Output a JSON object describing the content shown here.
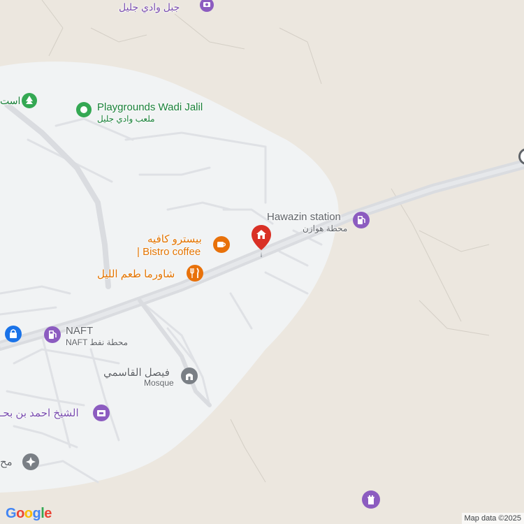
{
  "map": {
    "labels": {
      "jabal_wadi_jalil": "جبل وادي جليل",
      "playgrounds_en": "Playgrounds Wadi Jalil",
      "playgrounds_ar": "ملعب وادي جليل",
      "hawazin_en": "Hawazin station",
      "hawazin_ar": "محطة هوازن",
      "bistro_ar": "بيسترو كافيه",
      "bistro_en": "| Bistro coffee",
      "shawarma_ar": "شاورما طعم الليل",
      "naft_en": "NAFT",
      "naft_ar": "NAFT محطة نفط",
      "faisal_ar": "فيصل القاسمي",
      "faisal_en": "Mosque",
      "sheikh_ar": "الشيخ احمد بن بحـ",
      "left_edge_top": "است",
      "left_edge_bottom": "مح"
    },
    "attribution": "Map data ©2025",
    "logo_text": "Google",
    "colors": {
      "land": "#ece7df",
      "urban": "#f1f3f4",
      "road": "#dadce0",
      "poi_green": "#34a853",
      "poi_orange": "#e8710a",
      "poi_purple": "#8c5cc0",
      "poi_gray": "#7a7f85",
      "poi_blue": "#1a73e8",
      "marker_red": "#d93025"
    }
  }
}
